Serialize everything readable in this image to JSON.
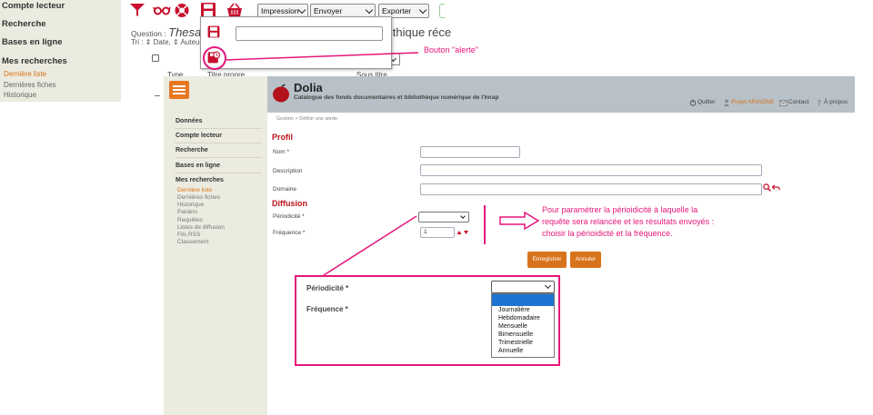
{
  "background_page": {
    "sidebar": {
      "items": [
        {
          "label": "Compte lecteur"
        },
        {
          "label": "Recherche"
        },
        {
          "label": "Bases en ligne"
        },
        {
          "label": "Mes recherches"
        }
      ],
      "subitems": [
        {
          "label": "Dernière liste",
          "active": true
        },
        {
          "label": "Dernières fiches",
          "active": false
        },
        {
          "label": "Historique",
          "active": false
        }
      ]
    },
    "toolbar": {
      "icons": [
        "funnel-icon",
        "glasses-icon",
        "lifebuoy-icon",
        "save-alert-icon",
        "basket-icon"
      ],
      "selects": [
        {
          "label": "Impression"
        },
        {
          "label": "Envoyer"
        },
        {
          "label": "Exporter"
        }
      ]
    },
    "question_label": "Question :",
    "question_value": "Thesaur",
    "question_tail": "lithique réce",
    "sort_text": "Tri : ⇕ Date, ⇕ Auteur",
    "partial_columns": [
      "Type",
      "Titre propre",
      "Sous titre"
    ],
    "popup": {
      "input_value": ""
    }
  },
  "annotations": {
    "alert_callout": "Bouton \"alerte\"",
    "period_callout_lines": [
      "Pour paramétrer la périoidicité à laquelle la",
      "requête sera relancée et les résultats envoyés :",
      "choisir la périoidicté et la fréquence."
    ],
    "accent_color": "#e5177b"
  },
  "app": {
    "title": "Dolia",
    "subtitle": "Catalogue des fonds documentaires et bibliothèque numérique de l'Inrap",
    "header_links": [
      {
        "label": "Quitter",
        "icon": "power-icon"
      },
      {
        "label": "Projet ARIADNE",
        "icon": "user-icon"
      },
      {
        "label": "Contact",
        "icon": "mail-icon"
      },
      {
        "label": "À propos",
        "icon": "question-icon"
      }
    ],
    "sidebar": {
      "items": [
        {
          "label": "Données"
        },
        {
          "label": "Compte lecteur"
        },
        {
          "label": "Recherche"
        },
        {
          "label": "Bases en ligne"
        },
        {
          "label": "Mes recherches"
        }
      ],
      "subitems": [
        {
          "label": "Dernière liste",
          "active": true
        },
        {
          "label": "Dernières fiches"
        },
        {
          "label": "Historique"
        },
        {
          "label": "Paniers"
        },
        {
          "label": "Requêtes"
        },
        {
          "label": "Listes de diffusion"
        },
        {
          "label": "Fils RSS"
        },
        {
          "label": "Classement"
        }
      ]
    },
    "breadcrumb": "Gestion > Définir une alerte",
    "profil": {
      "title": "Profil",
      "fields": [
        {
          "label": "Nom *",
          "value": ""
        },
        {
          "label": "Description",
          "value": ""
        },
        {
          "label": "Domaine",
          "value": ""
        }
      ]
    },
    "diffusion": {
      "title": "Diffusion",
      "periodicite_label": "Périodicité *",
      "periodicite_value": "",
      "frequence_label": "Fréquence *",
      "frequence_value": "1"
    },
    "buttons": {
      "save": "Enregistrer",
      "cancel": "Annuler"
    },
    "colors": {
      "brand_orange": "#d9731b",
      "header_bg": "#b7c1c7",
      "section_red": "#b8131a"
    }
  },
  "zoom": {
    "periodicite_label": "Périodicité *",
    "frequence_label": "Fréquence *",
    "options": [
      "Journalière",
      "Hebdomadaire",
      "Mensuelle",
      "Bimensuelle",
      "Trimestrielle",
      "Annuelle"
    ],
    "highlight_color": "#1e74d2"
  }
}
